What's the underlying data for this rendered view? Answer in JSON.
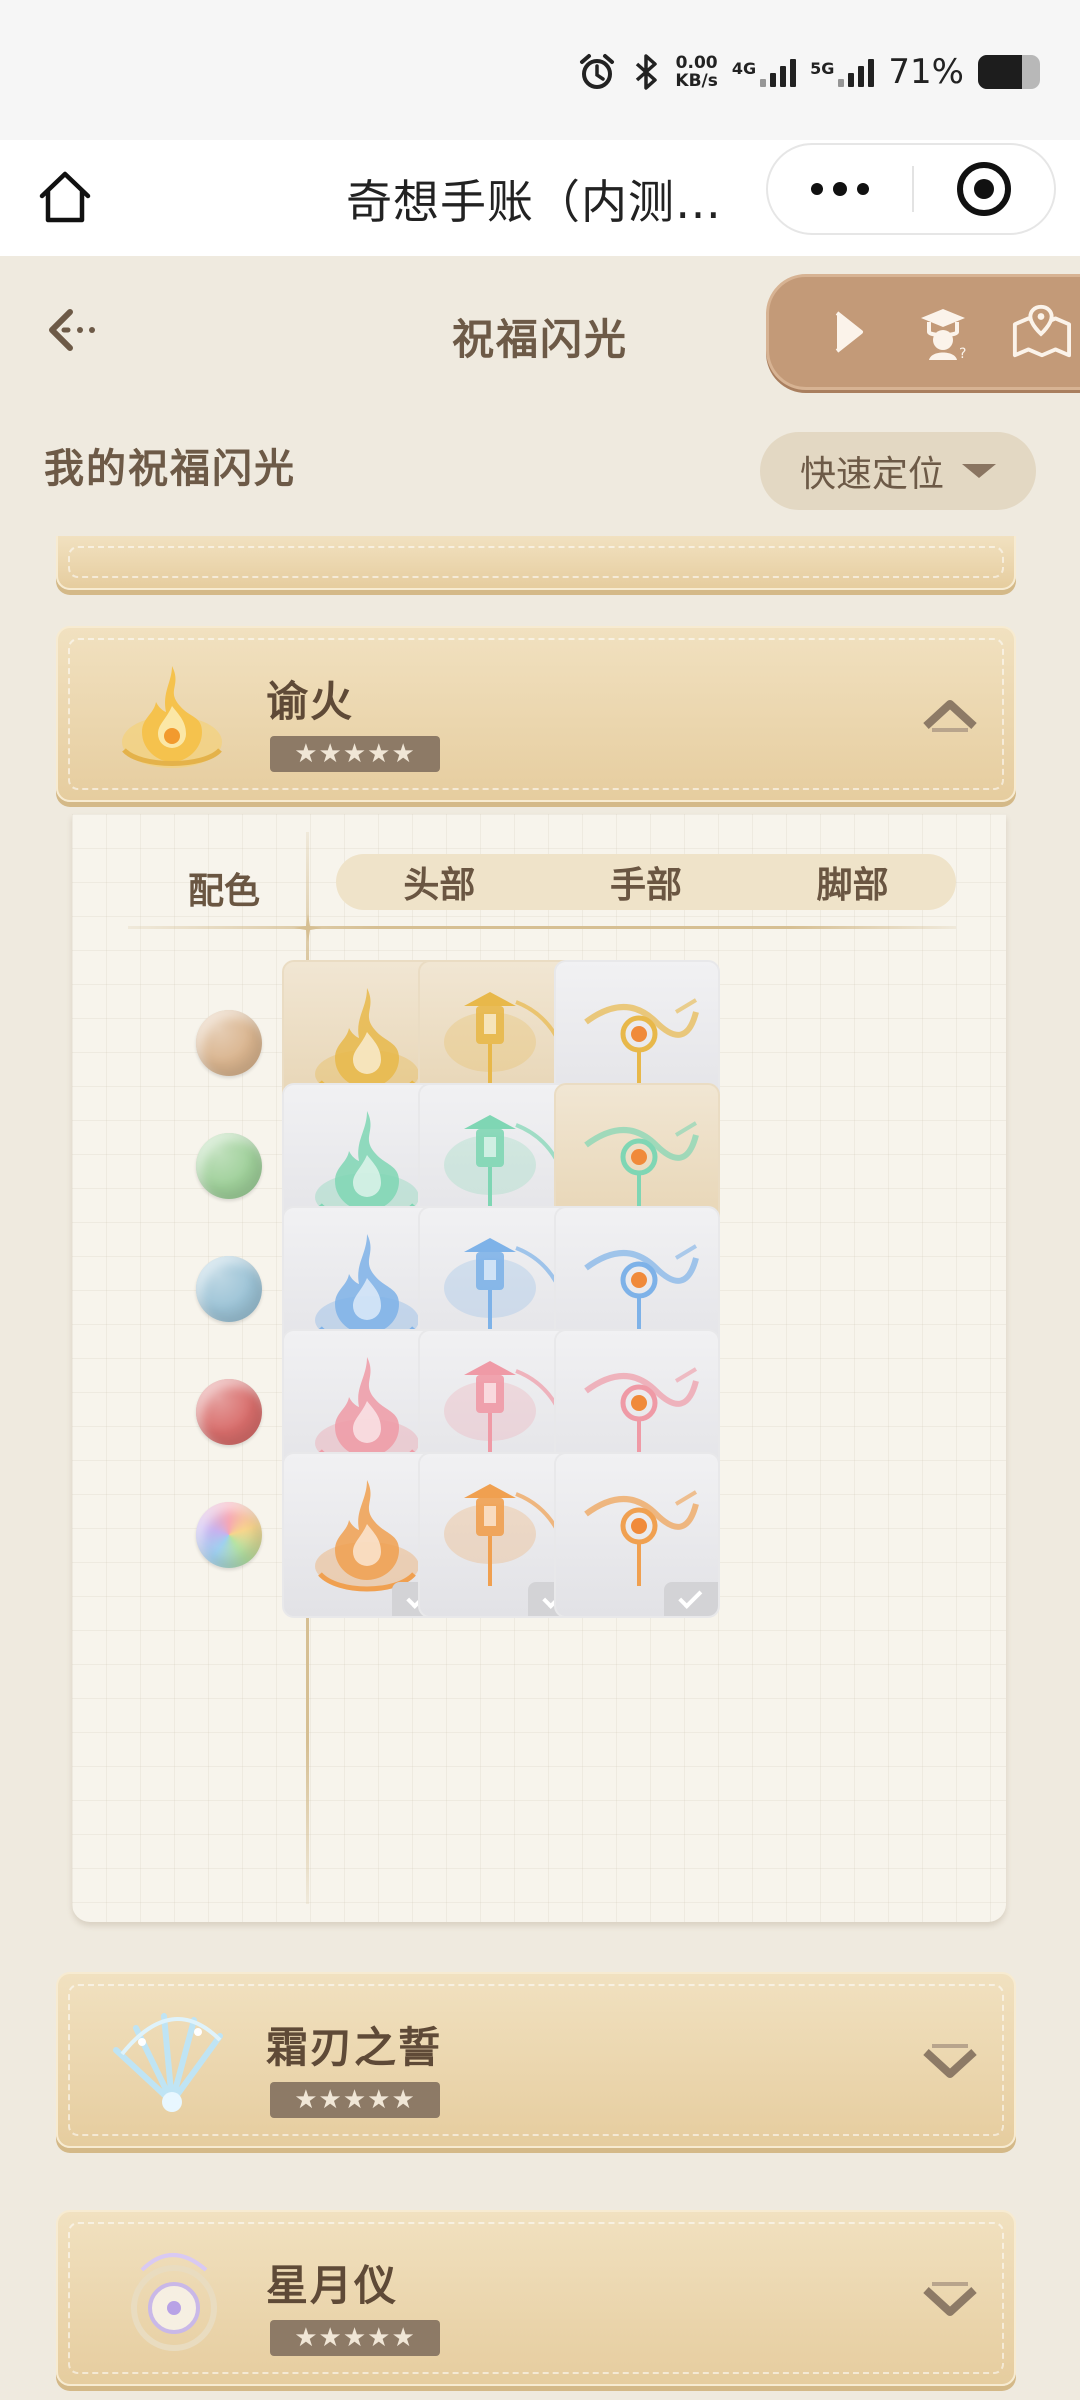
{
  "status_bar": {
    "speed_value": "0.00",
    "speed_unit": "KB/s",
    "net1": "4G",
    "net2": "5G",
    "battery_pct": "71%",
    "battery_level": 0.71,
    "icons": [
      "alarm-icon",
      "bluetooth-icon",
      "signal-4g-icon",
      "signal-5g-icon",
      "battery-icon"
    ]
  },
  "topbar": {
    "title": "奇想手账（内测…",
    "icons": [
      "home-icon",
      "more-icon",
      "close-target-icon"
    ]
  },
  "page": {
    "title": "祝福闪光",
    "section_title": "我的祝福闪光",
    "quick_locate": "快速定位",
    "tool_icons": [
      "play-icon",
      "guide-icon",
      "map-icon"
    ]
  },
  "cards": [
    {
      "name": "谕火",
      "stars": "★★★★★",
      "expanded": true
    },
    {
      "name": "霜刃之誓",
      "stars": "★★★★★",
      "expanded": false
    },
    {
      "name": "星月仪",
      "stars": "★★★★★",
      "expanded": false
    }
  ],
  "grid": {
    "color_header": "配色",
    "columns": [
      "头部",
      "手部",
      "脚部"
    ],
    "rows": [
      {
        "color_name": "gold",
        "swatch": "#d9b48e",
        "art": "#e8b84a",
        "owned": [
          true,
          true,
          false
        ]
      },
      {
        "color_name": "green",
        "swatch": "#9fd09a",
        "art": "#7fd6b4",
        "owned": [
          false,
          false,
          true
        ]
      },
      {
        "color_name": "blue",
        "swatch": "#9cc3d6",
        "art": "#7eb2e8",
        "owned": [
          false,
          false,
          false
        ]
      },
      {
        "color_name": "red",
        "swatch": "#d86d6b",
        "art": "#ef9aa6",
        "owned": [
          false,
          false,
          false
        ]
      },
      {
        "color_name": "rainbow",
        "swatch": "rainbow",
        "art": "#f0a050",
        "owned": [
          false,
          false,
          false
        ]
      }
    ]
  },
  "colors": {
    "accent": "#c39a78",
    "card_bg": "#e6cd9f",
    "check_on": "#e38b94",
    "check_off": "#d3d3d6"
  }
}
